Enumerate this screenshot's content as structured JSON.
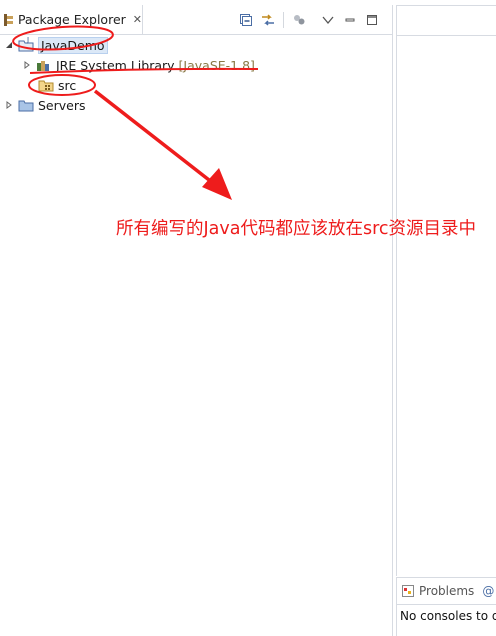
{
  "package_explorer": {
    "tab_title": "Package Explorer",
    "close_glyph": "✕",
    "icons": {
      "view_icon": "package-explorer-icon",
      "collapse_all": "collapse-all-icon",
      "link_with_editor": "link-with-editor-icon",
      "filters": "filters-icon",
      "view_menu": "view-menu-icon",
      "minimize": "minimize-icon",
      "maximize": "maximize-icon"
    }
  },
  "tree": {
    "items": [
      {
        "label": "JavaDemo",
        "expanded": true,
        "icon": "java-project-icon"
      },
      {
        "label": "JRE System Library",
        "decoration": "[JavaSE-1.8]",
        "expanded": false,
        "icon": "library-icon"
      },
      {
        "label": "src",
        "icon": "source-folder-icon"
      },
      {
        "label": "Servers",
        "expanded": false,
        "icon": "folder-icon"
      }
    ]
  },
  "annotation": {
    "text": "所有编写的Java代码都应该放在src资源目录中",
    "color": "#ee1c1c"
  },
  "bottom_panel": {
    "tabs": [
      {
        "label": "Problems",
        "icon": "problems-icon"
      },
      {
        "label": "@",
        "icon": "javadoc-icon"
      }
    ],
    "console_text": "No consoles to d"
  },
  "colors": {
    "accent": "#2b5fb3",
    "selection": "#dbe8f7",
    "annotation_red": "#ee1c1c",
    "decoration": "#8a7a46"
  }
}
